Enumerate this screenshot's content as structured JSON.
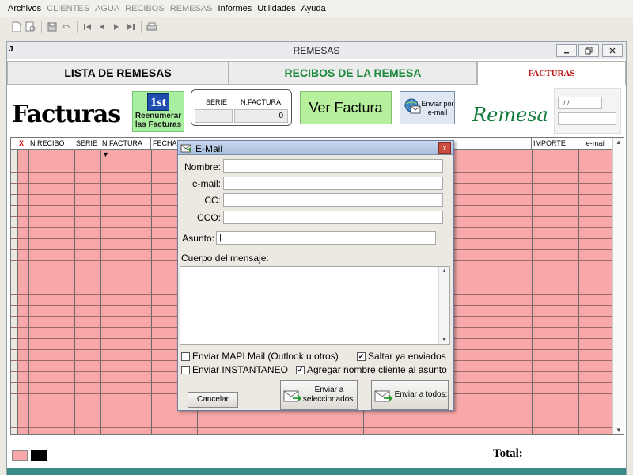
{
  "menu": {
    "items": [
      {
        "label": "Archivos",
        "enabled": true
      },
      {
        "label": "CLIENTES",
        "enabled": false
      },
      {
        "label": "AGUA",
        "enabled": false
      },
      {
        "label": "RECIBOS",
        "enabled": false
      },
      {
        "label": "REMESAS",
        "enabled": false
      },
      {
        "label": "Informes",
        "enabled": true
      },
      {
        "label": "Utilidades",
        "enabled": true
      },
      {
        "label": "Ayuda",
        "enabled": true
      }
    ]
  },
  "toolbar": {
    "icons": [
      "new-document-icon",
      "print-preview-icon",
      "save-icon",
      "undo-icon",
      "first-record-icon",
      "previous-record-icon",
      "next-record-icon",
      "last-record-icon",
      "print-icon"
    ]
  },
  "window": {
    "title": "REMESAS",
    "icon_glyph": "J"
  },
  "tabs": {
    "lista": "LISTA DE REMESAS",
    "recibos": "RECIBOS DE LA REMESA",
    "facturas": "FACTURAS"
  },
  "header": {
    "facturas_title": "Facturas",
    "renumerar_badge": "1st",
    "renumerar_label": "Reenumerar las Facturas",
    "serie_label": "SERIE",
    "nfactura_label": "N.FACTURA",
    "serie_value": "",
    "nfactura_value": "0",
    "ver_factura": "Ver Factura",
    "enviar_por_email": "Enviar por e-mail",
    "remesa_title": "Remesa",
    "remesa_date": "/ /"
  },
  "grid": {
    "columns": [
      "X",
      "N.RECIBO",
      "SERIE",
      "N.FACTURA",
      "FECHA",
      "IMPORTE",
      "e-mail"
    ]
  },
  "footer": {
    "total_label": "Total:"
  },
  "dialog": {
    "title": "E-Mail",
    "nombre_label": "Nombre:",
    "email_label": "e-mail:",
    "cc_label": "CC:",
    "cco_label": "CCO:",
    "asunto_label": "Asunto:",
    "cuerpo_label": "Cuerpo del mensaje:",
    "nombre_value": "",
    "email_value": "",
    "cc_value": "",
    "cco_value": "",
    "asunto_value": "|",
    "chk_mapi": "Enviar MAPI Mail (Outlook u otros)",
    "chk_saltar": "Saltar ya enviados",
    "chk_instantaneo": "Enviar INSTANTANEO",
    "chk_agregar": "Agregar nombre cliente al asunto",
    "chk_mapi_checked": false,
    "chk_saltar_checked": true,
    "chk_instantaneo_checked": false,
    "chk_agregar_checked": true,
    "btn_cancelar": "Cancelar",
    "btn_enviar_sel": "Enviar a seleccionados:",
    "btn_enviar_todos": "Enviar a todos:"
  }
}
